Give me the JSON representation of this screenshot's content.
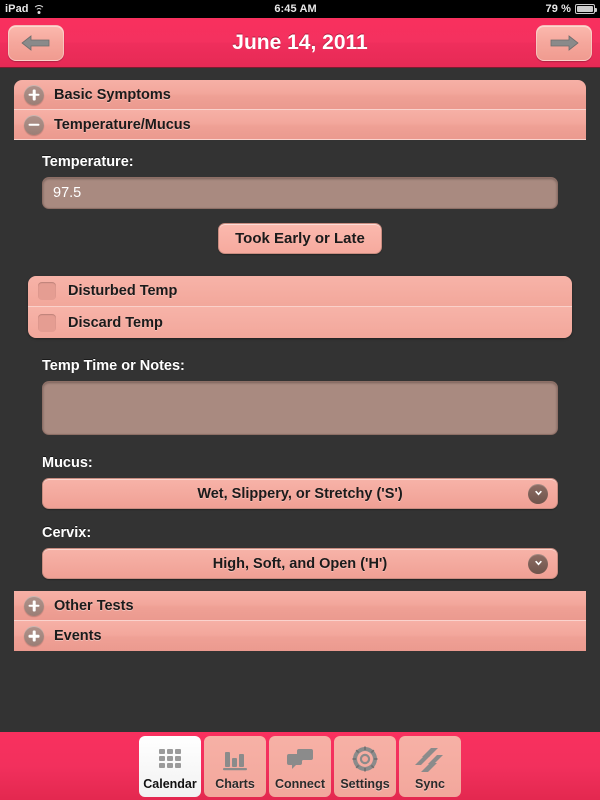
{
  "status_bar": {
    "device": "iPad",
    "wifi_icon": "wifi-icon",
    "time": "6:45 AM",
    "battery_percent": "79 %",
    "battery_icon": "battery-icon"
  },
  "nav_bar": {
    "title": "June 14, 2011",
    "prev_icon": "arrow-left-icon",
    "next_icon": "arrow-right-icon"
  },
  "sections": [
    {
      "label": "Basic Symptoms",
      "state": "collapsed",
      "toggle_icon": "plus-circle-icon"
    },
    {
      "label": "Temperature/Mucus",
      "state": "expanded",
      "toggle_icon": "minus-circle-icon"
    },
    {
      "label": "Other Tests",
      "state": "collapsed",
      "toggle_icon": "plus-circle-icon"
    },
    {
      "label": "Events",
      "state": "collapsed",
      "toggle_icon": "plus-circle-icon"
    }
  ],
  "form": {
    "temperature": {
      "label": "Temperature:",
      "value": "97.5",
      "placeholder": ""
    },
    "took_early_or_late_button": "Took Early or Late",
    "checkboxes": [
      {
        "label": "Disturbed Temp",
        "checked": false
      },
      {
        "label": "Discard Temp",
        "checked": false
      }
    ],
    "notes": {
      "label": "Temp Time or Notes:",
      "value": "",
      "placeholder": ""
    },
    "mucus": {
      "label": "Mucus:",
      "value": "Wet, Slippery, or Stretchy ('S')",
      "chevron_icon": "chevron-down-icon"
    },
    "cervix": {
      "label": "Cervix:",
      "value": "High, Soft, and Open ('H')",
      "chevron_icon": "chevron-down-icon"
    }
  },
  "tab_bar": {
    "tabs": [
      {
        "label": "Calendar",
        "icon": "calendar-grid-icon",
        "active": true
      },
      {
        "label": "Charts",
        "icon": "bar-chart-icon",
        "active": false
      },
      {
        "label": "Connect",
        "icon": "speech-bubbles-icon",
        "active": false
      },
      {
        "label": "Settings",
        "icon": "gear-icon",
        "active": false
      },
      {
        "label": "Sync",
        "icon": "sync-slashes-icon",
        "active": false
      }
    ]
  },
  "colors": {
    "accent_pink": "#f9305e",
    "section_pink": "#f3a79c",
    "background_dark": "#333333",
    "input_mauve": "#a98a80"
  }
}
